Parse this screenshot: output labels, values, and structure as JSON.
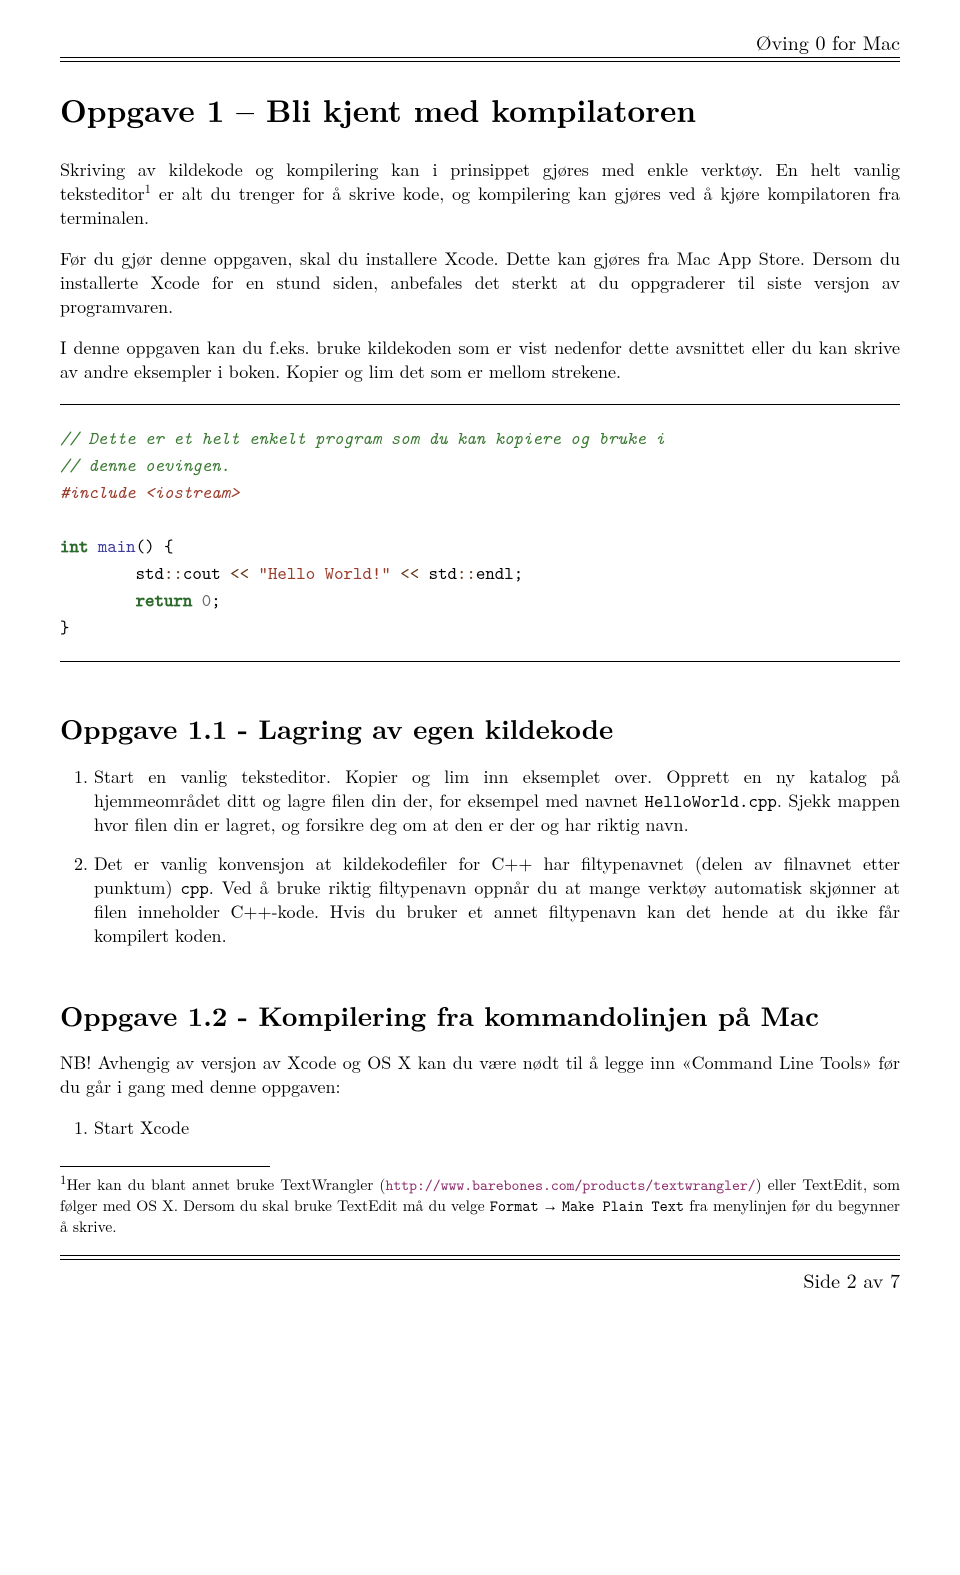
{
  "header": {
    "right": "Øving 0 for Mac"
  },
  "h1": "Oppgave 1 – Bli kjent med kompilatoren",
  "p1a": "Skriving av kildekode og kompilering kan i prinsippet gjøres med enkle verktøy. En helt vanlig teksteditor",
  "p1b": " er alt du trenger for å skrive kode, og kompilering kan gjøres ved å kjøre kompilatoren fra terminalen.",
  "p2": "Før du gjør denne oppgaven, skal du installere Xcode. Dette kan gjøres fra Mac App Store. Dersom du installerte Xcode for en stund siden, anbefales det sterkt at du oppgraderer til siste versjon av programvaren.",
  "p3": "I denne oppgaven kan du f.eks. bruke kildekoden som er vist nedenfor dette avsnittet eller du kan skrive av andre eksempler i boken. Kopier og lim det som er mellom strekene.",
  "code": {
    "c1": "// Dette er et helt enkelt program som du kan kopiere og bruke i",
    "c2": "// denne oevingen.",
    "inc": "#include <iostream>",
    "kw_int": "int",
    "fn_main": "main",
    "open": "() {",
    "std1": "std",
    "dcolon": "::",
    "cout": "cout",
    "lshift": " << ",
    "str": "\"Hello World!\"",
    "endl": "endl",
    "semi": ";",
    "kw_return": "return",
    "zero": " 0",
    "close": "}"
  },
  "h2a": "Oppgave 1.1 - Lagring av egen kildekode",
  "ol1": {
    "i1a": "Start en vanlig teksteditor. Kopier og lim inn eksemplet over. Opprett en ny katalog på hjemmeområdet ditt og lagre filen din der, for eksempel med navnet ",
    "i1tt": "HelloWorld.cpp",
    "i1b": ". Sjekk mappen hvor filen din er lagret, og forsikre deg om at den er der og har riktig navn.",
    "i2a": "Det er vanlig konvensjon at kildekodefiler for C++ har filtypenavnet (delen av filnavnet etter punktum) ",
    "i2tt": "cpp",
    "i2b": ". Ved å bruke riktig filtypenavn oppnår du at mange verktøy automatisk skjønner at filen inneholder C++-kode. Hvis du bruker et annet filtypenavn kan det hende at du ikke får kompilert koden."
  },
  "h2b": "Oppgave 1.2 - Kompilering fra kommandolinjen på Mac",
  "p4": "NB! Avhengig av versjon av Xcode og OS X kan du være nødt til å legge inn «Command Line Tools» før du går i gang med denne oppgaven:",
  "ol2": {
    "i1": "Start Xcode"
  },
  "footnote": {
    "marker": "1",
    "a": "Her kan du blant annet bruke TextWrangler (",
    "url": "http://www.barebones.com/products/textwrangler/",
    "b": ") eller TextEdit, som følger med OS X. Dersom du skal bruke TextEdit må du velge ",
    "tt1": "Format",
    "arrow": " → ",
    "tt2": "Make Plain Text",
    "c": " fra menylinjen før du begynner å skrive."
  },
  "footer": {
    "side": "Side ",
    "cur": "2",
    "av": " av ",
    "tot": "7"
  }
}
